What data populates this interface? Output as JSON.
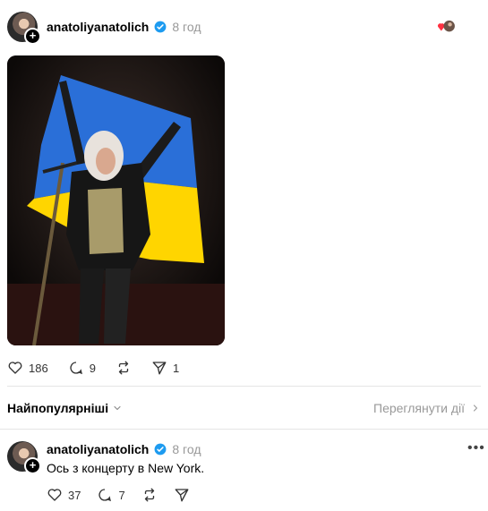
{
  "post": {
    "username": "anatoliyanatolich",
    "time": "8 год",
    "likes": "186",
    "comments": "9",
    "shares": "1",
    "image_alt": "Performer on stage holding the Ukrainian flag",
    "flag_colors": {
      "blue": "#2a6fd8",
      "yellow": "#ffd500"
    }
  },
  "sort": {
    "label": "Найпопулярніші",
    "activity_link": "Переглянути дії"
  },
  "reply": {
    "username": "anatoliyanatolich",
    "time": "8 год",
    "text": "Ось з концерту в New York.",
    "likes": "37",
    "comments": "7"
  },
  "colors": {
    "verified": "#1d9bf0",
    "muted": "#999999",
    "divider": "#e5e5e5"
  }
}
